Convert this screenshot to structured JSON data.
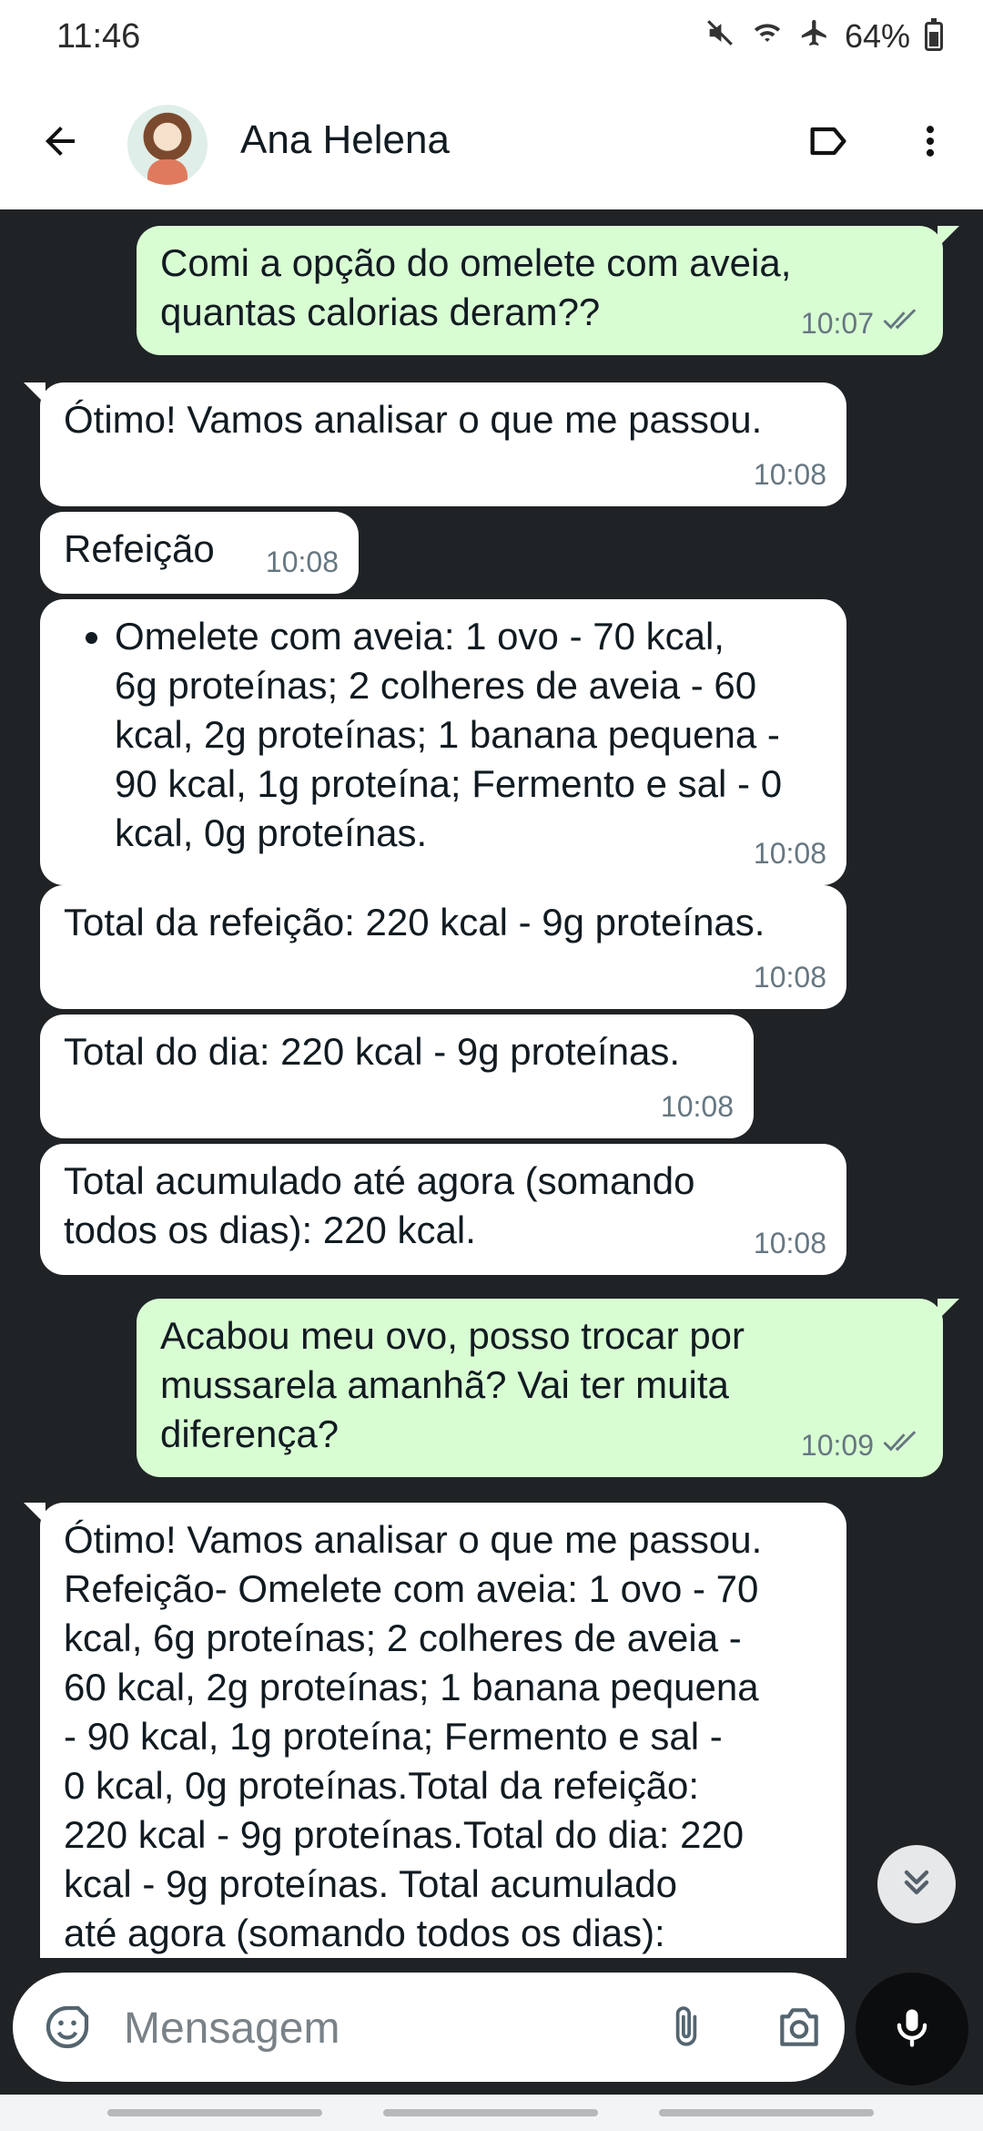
{
  "status_bar": {
    "time": "11:46",
    "battery": "64%",
    "icons": [
      "mute-icon",
      "wifi-icon",
      "airplane-icon",
      "battery-icon"
    ]
  },
  "header": {
    "contact_name": "Ana Helena",
    "icons": [
      "back-arrow-icon",
      "label-icon",
      "more-vert-icon"
    ]
  },
  "messages": [
    {
      "direction": "out",
      "text": "Comi a opção do omelete com aveia,\nquantas calorias deram??",
      "time": "10:07",
      "status": "read"
    },
    {
      "direction": "in",
      "text": "Ótimo! Vamos analisar o que me passou.",
      "time": "10:08"
    },
    {
      "direction": "in",
      "text": "Refeição",
      "time": "10:08"
    },
    {
      "direction": "in",
      "bullet": "Omelete com aveia: 1 ovo - 70 kcal,\n6g proteínas; 2 colheres de aveia - 60\nkcal, 2g proteínas; 1 banana pequena -\n90 kcal, 1g proteína; Fermento e sal - 0\nkcal, 0g proteínas.",
      "time": "10:08"
    },
    {
      "direction": "in",
      "text": "Total da refeição: 220 kcal - 9g proteínas.",
      "time": "10:08"
    },
    {
      "direction": "in",
      "text": "Total do dia: 220 kcal - 9g proteínas.",
      "time": "10:08"
    },
    {
      "direction": "in",
      "text": "Total acumulado até agora (somando\ntodos os dias): 220 kcal.",
      "time": "10:08"
    },
    {
      "direction": "out",
      "text": "Acabou meu ovo, posso trocar por\nmussarela amanhã? Vai ter muita\ndiferença?",
      "time": "10:09",
      "status": "read"
    },
    {
      "direction": "in",
      "text": "Ótimo! Vamos analisar o que me passou.\nRefeição- Omelete com aveia: 1 ovo - 70\nkcal, 6g proteínas; 2 colheres de aveia -\n60 kcal, 2g proteínas; 1 banana pequena\n- 90 kcal, 1g proteína; Fermento e sal -\n0 kcal, 0g proteínas.Total da refeição:\n220 kcal - 9g proteínas.Total do dia: 220\nkcal - 9g proteínas. Total acumulado\naté agora (somando todos os dias):"
    }
  ],
  "composer": {
    "placeholder": "Mensagem",
    "icons": [
      "emoji-icon",
      "attach-icon",
      "camera-icon",
      "mic-icon"
    ]
  },
  "colors": {
    "chat_background": "#1f2326",
    "incoming_bubble": "#ffffff",
    "outgoing_bubble": "#d9fdd3"
  }
}
